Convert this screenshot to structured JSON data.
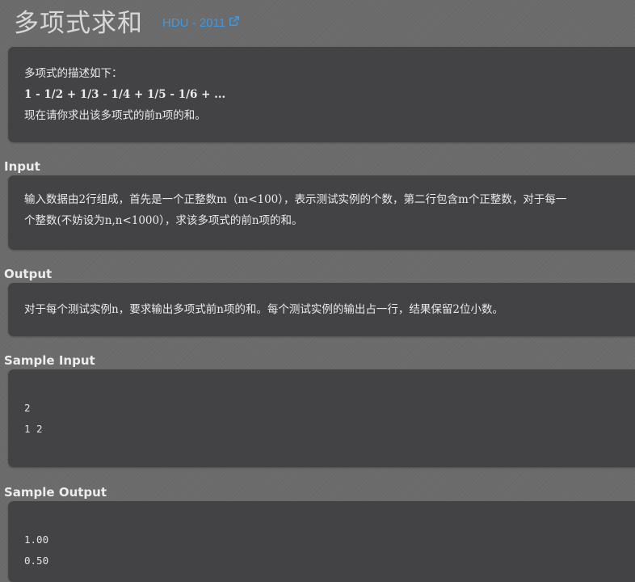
{
  "header": {
    "title": "多项式求和",
    "source_label": "HDU - 2011",
    "source_icon": "external-link-icon",
    "link_color": "#3b9ae8"
  },
  "description": {
    "lines": [
      "多项式的描述如下：",
      "1 - 1/2 + 1/3 - 1/4 + 1/5 - 1/6 + ...",
      "现在请你求出该多项式的前n项的和。"
    ]
  },
  "input": {
    "heading": "Input",
    "lines": [
      "输入数据由2行组成，首先是一个正整数m（m<100），表示测试实例的个数，第二行包含m个正整数，对于每一",
      "个整数(不妨设为n,n<1000），求该多项式的前n项的和。"
    ]
  },
  "output": {
    "heading": "Output",
    "lines": [
      "对于每个测试实例n，要求输出多项式前n项的和。每个测试实例的输出占一行，结果保留2位小数。"
    ]
  },
  "sample_input": {
    "heading": "Sample Input",
    "lines": [
      "2",
      "1 2"
    ]
  },
  "sample_output": {
    "heading": "Sample Output",
    "lines": [
      "1.00",
      "0.50"
    ]
  }
}
